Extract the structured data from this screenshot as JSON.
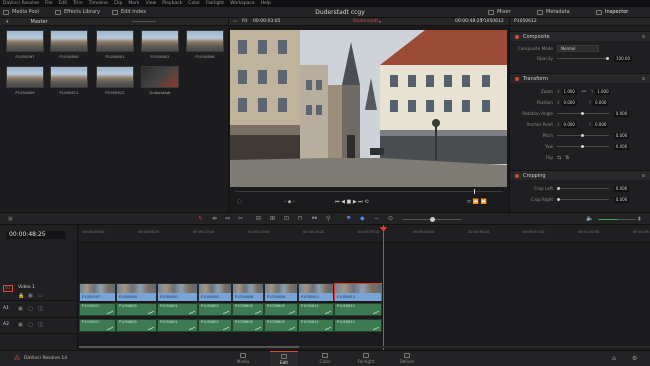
{
  "menu": [
    "DaVinci Resolve",
    "File",
    "Edit",
    "Trim",
    "Timeline",
    "Clip",
    "Mark",
    "View",
    "Playback",
    "Color",
    "Fairlight",
    "Workspace",
    "Help"
  ],
  "toolbar": {
    "media_pool": "Media Pool",
    "effects_library": "Effects Library",
    "edit_index": "Edit Index",
    "project_title": "Duderstadt ccgy",
    "mixer": "Mixer",
    "metadata": "Metadata",
    "inspector": "Inspector"
  },
  "media_pool": {
    "bin": "Master",
    "clips": [
      "P1050597",
      "P1050600",
      "P1050601",
      "P1050602",
      "P1050606",
      "P1050609",
      "P1050611",
      "P1050612",
      "Duderstadt"
    ]
  },
  "viewer": {
    "fit": "Fit",
    "source_timecode": "00:00:03:05",
    "timeline_name": "Duderstadt",
    "record_timecode": "00:00:48:25",
    "clip_name": "P1050612"
  },
  "inspector": {
    "composite": {
      "title": "Composite",
      "mode_label": "Composite Mode",
      "mode_value": "Normal",
      "opacity_label": "Opacity",
      "opacity_value": "100.00"
    },
    "transform": {
      "title": "Transform",
      "zoom_label": "Zoom",
      "zoom_x": "1.000",
      "zoom_y": "1.000",
      "position_label": "Position",
      "position_x": "0.000",
      "position_y": "0.000",
      "rotation_label": "Rotation Angle",
      "rotation_value": "0.000",
      "anchor_label": "Anchor Point",
      "anchor_x": "0.000",
      "anchor_y": "0.000",
      "pitch_label": "Pitch",
      "pitch_value": "0.000",
      "yaw_label": "Yaw",
      "yaw_value": "0.000",
      "flip_label": "Flip",
      "x": "X",
      "y": "Y"
    },
    "cropping": {
      "title": "Cropping",
      "crop_left_label": "Crop Left",
      "crop_left_value": "0.000",
      "crop_right_label": "Crop Right",
      "crop_right_value": "0.000"
    }
  },
  "timeline": {
    "timecode": "00:00:48:25",
    "ruler_ticks": [
      "00:00:00:00",
      "00:00:06:20",
      "00:00:13:10",
      "00:00:20:00",
      "00:00:26:20",
      "00:00:33:10",
      "00:00:40:00",
      "00:00:46:20",
      "00:00:53:10",
      "00:01:00:00",
      "00:01:06:20"
    ],
    "video_track": {
      "id": "V1",
      "name": "Video 1"
    },
    "audio_tracks": [
      {
        "id": "A1"
      },
      {
        "id": "A2"
      }
    ],
    "clips": [
      "P1050597",
      "P1050600",
      "P1050601",
      "P1050602",
      "P1050606",
      "P1050609",
      "P1050611",
      "P1050612"
    ]
  },
  "pages": [
    "Media",
    "Edit",
    "Color",
    "Fairlight",
    "Deliver"
  ],
  "brand": "DaVinci Resolve 14",
  "colors": {
    "accent": "#d94a3a",
    "video_clip": "#7aa3d6",
    "audio_clip": "#3d7a52",
    "playhead": "#e03b2d"
  }
}
